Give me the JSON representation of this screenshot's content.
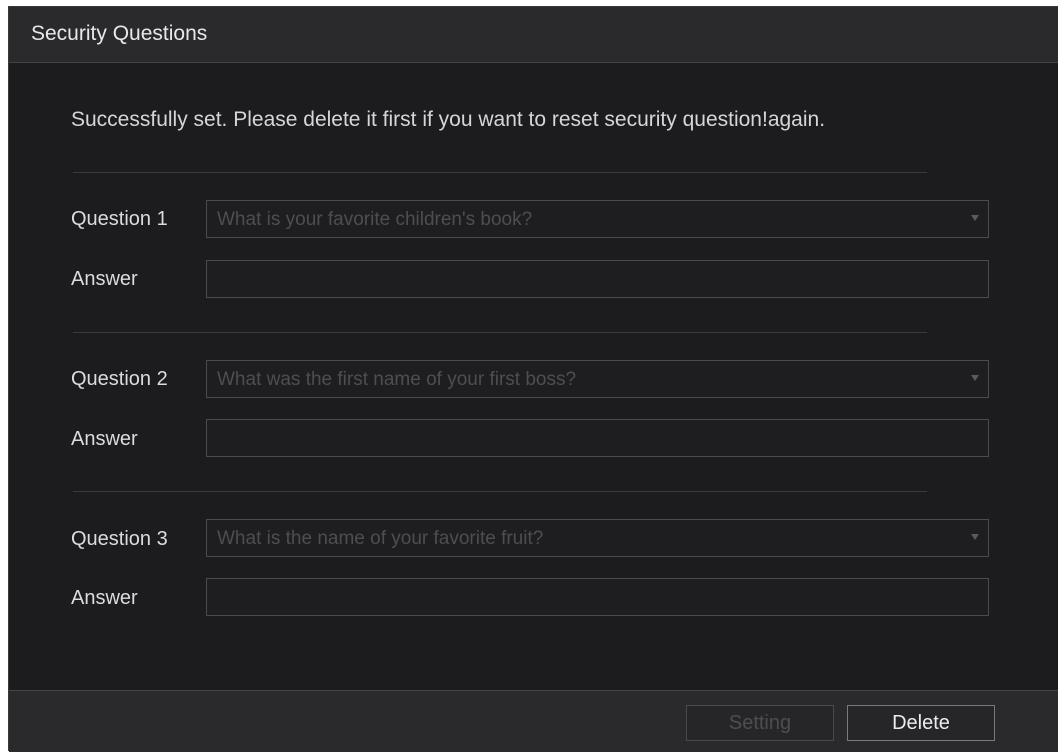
{
  "dialog": {
    "title": "Security Questions",
    "message": "Successfully set. Please delete it first if you want to reset security question!again."
  },
  "questions": [
    {
      "label": "Question 1",
      "selected": "What is your favorite children's book?",
      "answer_label": "Answer",
      "answer_value": ""
    },
    {
      "label": "Question 2",
      "selected": "What was the first name of your first boss?",
      "answer_label": "Answer",
      "answer_value": ""
    },
    {
      "label": "Question 3",
      "selected": "What is the name of your favorite fruit?",
      "answer_label": "Answer",
      "answer_value": ""
    }
  ],
  "footer": {
    "setting_label": "Setting",
    "delete_label": "Delete"
  },
  "colors": {
    "background": "#1c1c1e",
    "bar": "#2a2a2c",
    "disabled_text": "#4e4e50"
  },
  "icons": {
    "dropdown": "caret-down-icon"
  }
}
